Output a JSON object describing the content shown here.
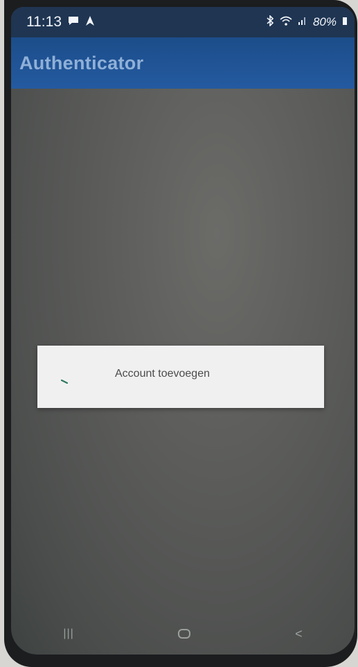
{
  "status_bar": {
    "time": "11:13",
    "battery": "80%",
    "icons": [
      "message-icon",
      "navigation-icon",
      "bluetooth-icon",
      "wifi-icon",
      "signal-icon",
      "battery-icon"
    ]
  },
  "app_bar": {
    "title": "Authenticator",
    "color": "#245aa0"
  },
  "menu": {
    "items": [
      {
        "label": "Account toevoegen",
        "icon": "key-icon"
      }
    ]
  },
  "nav_bar": {
    "recents_icon": "recents-icon",
    "home_icon": "home-icon",
    "back_icon": "back-icon"
  }
}
